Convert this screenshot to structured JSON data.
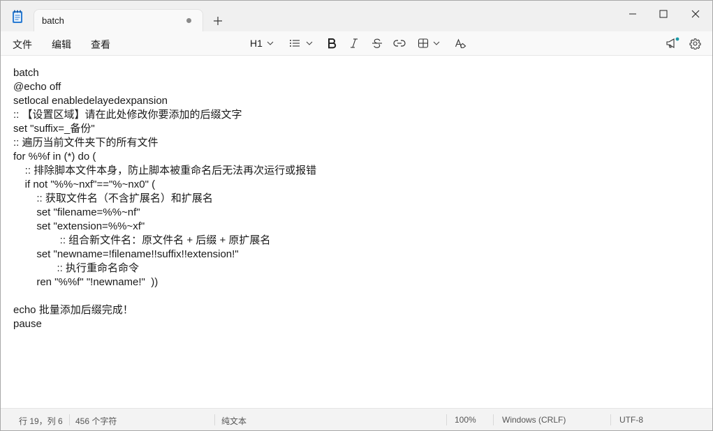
{
  "tab": {
    "title": "batch"
  },
  "menu": {
    "file": "文件",
    "edit": "编辑",
    "view": "查看"
  },
  "toolbar": {
    "heading_label": "H1"
  },
  "editor": {
    "lines": [
      "batch",
      "@echo off",
      "setlocal enabledelayedexpansion",
      ":: 【设置区域】请在此处修改你要添加的后缀文字",
      "set \"suffix=_备份\"",
      ":: 遍历当前文件夹下的所有文件",
      "for %%f in (*) do (",
      "    :: 排除脚本文件本身，防止脚本被重命名后无法再次运行或报错",
      "    if not \"%%~nxf\"==\"%~nx0\" (",
      "        :: 获取文件名（不含扩展名）和扩展名",
      "        set \"filename=%%~nf\"",
      "        set \"extension=%%~xf\"",
      "                :: 组合新文件名：原文件名 + 后缀 + 原扩展名",
      "        set \"newname=!filename!!suffix!!extension!\"",
      "               :: 执行重命名命令",
      "        ren \"%%f\" \"!newname!\"  ))",
      "",
      "echo 批量添加后缀完成！",
      "pause"
    ]
  },
  "status": {
    "position": "行 19，列 6",
    "char_count": "456 个字符",
    "format": "纯文本",
    "zoom": "100%",
    "line_ending": "Windows (CRLF)",
    "encoding": "UTF-8"
  },
  "colors": {
    "titlebar_bg": "#f0f0f0",
    "toolbar_bg": "#f9f9f9",
    "editor_bg": "#ffffff",
    "statusbar_bg": "#f3f3f3",
    "app_icon_blue": "#2b7cd3",
    "notification_dot": "#1a9ba8"
  },
  "icons": [
    "notepad-app-icon",
    "close-tab-icon",
    "add-tab-icon",
    "minimize-icon",
    "maximize-icon",
    "close-window-icon",
    "chevron-down-icon",
    "bullet-list-icon",
    "bold-icon",
    "italic-icon",
    "strikethrough-icon",
    "link-icon",
    "table-icon",
    "clear-formatting-icon",
    "copilot-megaphone-icon",
    "settings-gear-icon"
  ]
}
